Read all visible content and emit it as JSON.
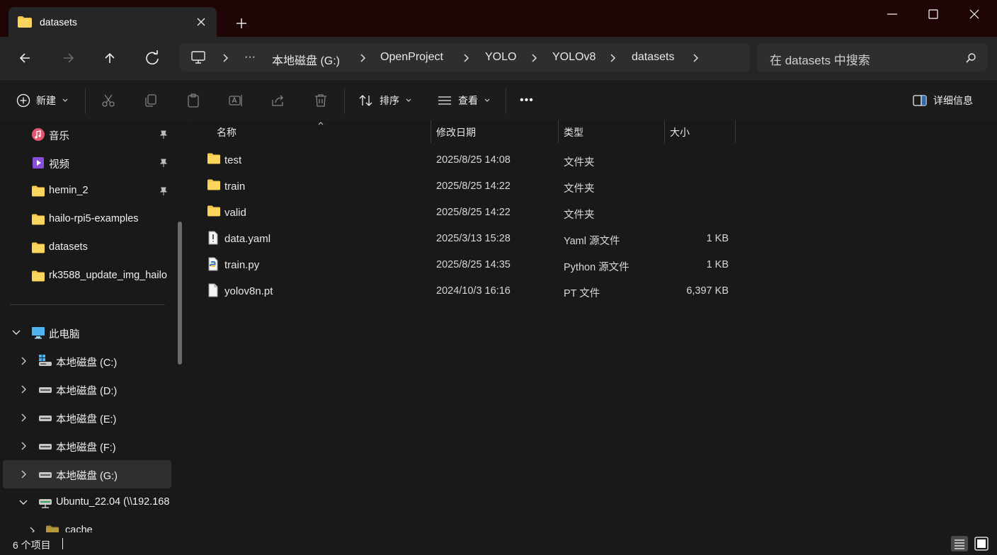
{
  "window": {
    "tab_title": "datasets",
    "new_tab": "+"
  },
  "nav": {
    "breadcrumbs": [
      "本地磁盘 (G:)",
      "OpenProject",
      "YOLO",
      "YOLOv8",
      "datasets"
    ],
    "more": "···",
    "search_placeholder": "在 datasets 中搜索"
  },
  "toolbar": {
    "new_label": "新建",
    "sort_label": "排序",
    "view_label": "查看",
    "more": "•••",
    "details_label": "详细信息"
  },
  "sidebar": {
    "quick_access": [
      {
        "label": "音乐",
        "icon": "music-icon",
        "pinned": true
      },
      {
        "label": "视频",
        "icon": "video-icon",
        "pinned": true
      },
      {
        "label": "hemin_2",
        "icon": "folder-icon",
        "pinned": true
      },
      {
        "label": "hailo-rpi5-examples",
        "icon": "folder-icon",
        "pinned": false
      },
      {
        "label": "datasets",
        "icon": "folder-icon",
        "pinned": false
      },
      {
        "label": "rk3588_update_img_hailo",
        "icon": "folder-icon",
        "pinned": false
      }
    ],
    "this_pc": "此电脑",
    "drives": [
      {
        "label": "本地磁盘 (C:)",
        "icon": "windows-drive-icon"
      },
      {
        "label": "本地磁盘 (D:)",
        "icon": "drive-icon"
      },
      {
        "label": "本地磁盘 (E:)",
        "icon": "drive-icon"
      },
      {
        "label": "本地磁盘 (F:)",
        "icon": "drive-icon"
      },
      {
        "label": "本地磁盘 (G:)",
        "icon": "drive-icon",
        "selected": true
      },
      {
        "label": "Ubuntu_22.04 (\\\\192.168",
        "icon": "network-drive-icon"
      }
    ],
    "child": "cache"
  },
  "columns": {
    "name": "名称",
    "modified": "修改日期",
    "type": "类型",
    "size": "大小"
  },
  "files": [
    {
      "name": "test",
      "modified": "2025/8/25 14:08",
      "type": "文件夹",
      "size": "",
      "icon": "folder-icon"
    },
    {
      "name": "train",
      "modified": "2025/8/25 14:22",
      "type": "文件夹",
      "size": "",
      "icon": "folder-icon"
    },
    {
      "name": "valid",
      "modified": "2025/8/25 14:22",
      "type": "文件夹",
      "size": "",
      "icon": "folder-icon"
    },
    {
      "name": "data.yaml",
      "modified": "2025/3/13 15:28",
      "type": "Yaml 源文件",
      "size": "1 KB",
      "icon": "yaml-file-icon"
    },
    {
      "name": "train.py",
      "modified": "2025/8/25 14:35",
      "type": "Python 源文件",
      "size": "1 KB",
      "icon": "python-file-icon"
    },
    {
      "name": "yolov8n.pt",
      "modified": "2024/10/3 16:16",
      "type": "PT 文件",
      "size": "6,397 KB",
      "icon": "file-icon"
    }
  ],
  "status": {
    "item_count": "6 个项目"
  },
  "colors": {
    "titlebar": "#1f0506",
    "folder": "#f8c948",
    "accent": "#3a8ee6"
  }
}
